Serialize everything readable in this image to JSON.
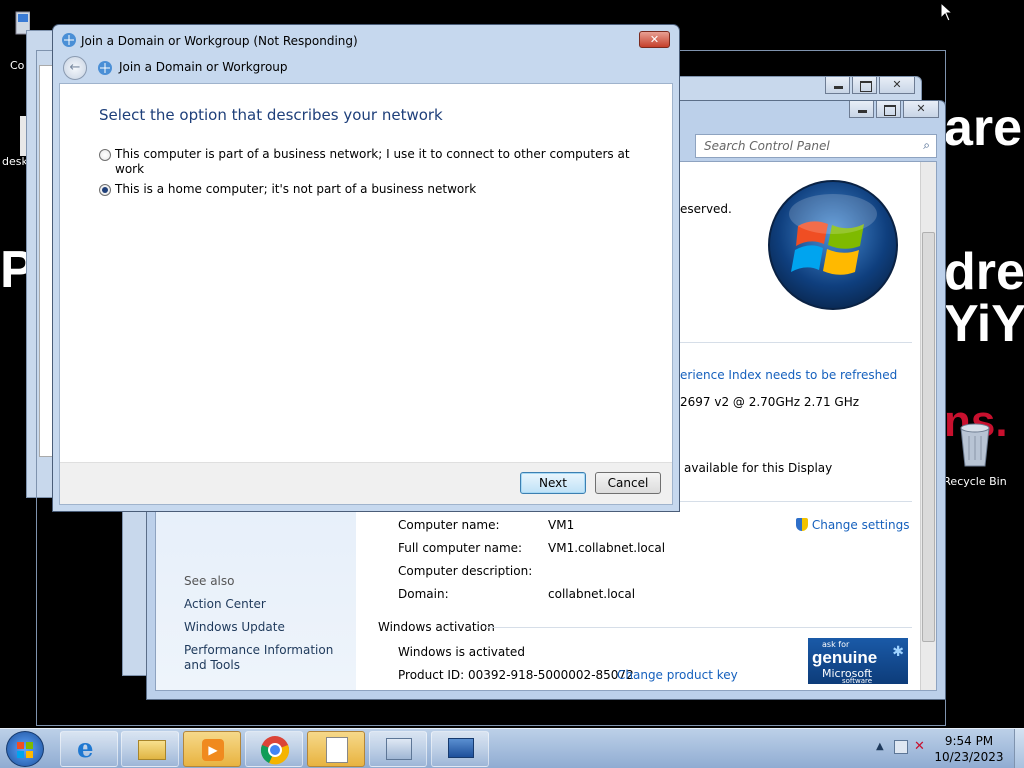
{
  "wallpaper": {
    "fragment_1": "are!",
    "fragment_2": "dres",
    "fragment_3": "YiY",
    "fragment_4": "ns.",
    "fragment_5": "P"
  },
  "desktop_icons": {
    "computer_label": "Co",
    "desktop_label": "desk",
    "recycle_bin_label": "Recycle Bin"
  },
  "system_window": {
    "search_placeholder": "Search Control Panel",
    "copyright_fragment": "eserved.",
    "wei_link": "erience Index needs to be refreshed",
    "processor_fragment": "2697 v2 @ 2.70GHz   2.71 GHz",
    "pen_touch_fragment": "available for this Display",
    "computer_name_label": "Computer name:",
    "computer_name_value": "VM1",
    "full_name_label": "Full computer name:",
    "full_name_value": "VM1.collabnet.local",
    "description_label": "Computer description:",
    "domain_label": "Domain:",
    "domain_value": "collabnet.local",
    "change_settings": "Change settings",
    "activation_heading": "Windows activation",
    "activation_status": "Windows is activated",
    "product_id": "Product ID: 00392-918-5000002-85072",
    "change_product_key": "Change product key",
    "see_also": "See also",
    "see_also_links": [
      "Action Center",
      "Windows Update",
      "Performance Information and Tools"
    ],
    "genuine": {
      "line1": "ask for",
      "line2": "genuine",
      "line3": "Microsoft",
      "line4": "software"
    }
  },
  "dialog": {
    "title": "Join a Domain or Workgroup (Not Responding)",
    "breadcrumb": "Join a Domain or Workgroup",
    "heading": "Select the option that describes your network",
    "option_business_line1": "This computer is part of a business network; I use it to connect to other computers at",
    "option_business_line2": "work",
    "option_home": "This is a home computer; it's not part of a business network",
    "selected_option": "home",
    "next_label": "Next",
    "cancel_label": "Cancel"
  },
  "taskbar": {
    "time": "9:54 PM",
    "date": "10/23/2023",
    "items": [
      "Internet Explorer",
      "Windows Explorer",
      "Windows Media Player",
      "Google Chrome",
      "File",
      "Control Panel",
      "Remote Desktop"
    ]
  },
  "colors": {
    "link": "#1560bd",
    "dialog_heading": "#1e3f7a",
    "wallpaper_red": "#c8102e"
  }
}
